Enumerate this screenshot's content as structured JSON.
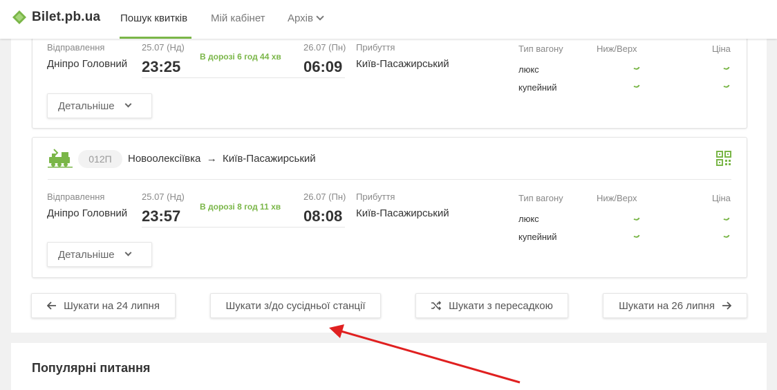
{
  "header": {
    "brand": "Bilet.pb.ua",
    "nav": [
      {
        "label": "Пошук квитків",
        "active": true
      },
      {
        "label": "Мій кабінет",
        "active": false
      },
      {
        "label": "Архів",
        "active": false
      }
    ]
  },
  "colors": {
    "accent": "#7ab648",
    "annotation": "#e02020"
  },
  "trains": [
    {
      "departure_label": "Відправлення",
      "departure_station": "Дніпро Головний",
      "departure_date": "25.07 (Нд)",
      "departure_time": "23:25",
      "on_road": "В дорозі  6 год 44 хв",
      "arrival_date": "26.07 (Пн)",
      "arrival_time": "06:09",
      "arrival_label": "Прибуття",
      "arrival_station": "Київ-Пасажирський",
      "wagon_type_header": "Тип вагону",
      "berth_header": "Ниж/Верх",
      "price_header": "Ціна",
      "wagons": [
        "люкс",
        "купейний"
      ],
      "details_label": "Детальніше"
    },
    {
      "number": "012П",
      "route_from": "Новоолексіївка",
      "route_arrow": "→",
      "route_to": "Київ-Пасажирський",
      "departure_label": "Відправлення",
      "departure_station": "Дніпро Головний",
      "departure_date": "25.07 (Нд)",
      "departure_time": "23:57",
      "on_road": "В дорозі  8 год 11 хв",
      "arrival_date": "26.07 (Пн)",
      "arrival_time": "08:08",
      "arrival_label": "Прибуття",
      "arrival_station": "Київ-Пасажирський",
      "wagon_type_header": "Тип вагону",
      "berth_header": "Ниж/Верх",
      "price_header": "Ціна",
      "wagons": [
        "люкс",
        "купейний"
      ],
      "details_label": "Детальніше"
    }
  ],
  "actions": {
    "prev_day": "Шукати на 24 липня",
    "nearby_station": "Шукати з/до сусідньої станції",
    "transfer": "Шукати з пересадкою",
    "next_day": "Шукати на 26 липня"
  },
  "popular": {
    "title": "Популярні питання"
  }
}
